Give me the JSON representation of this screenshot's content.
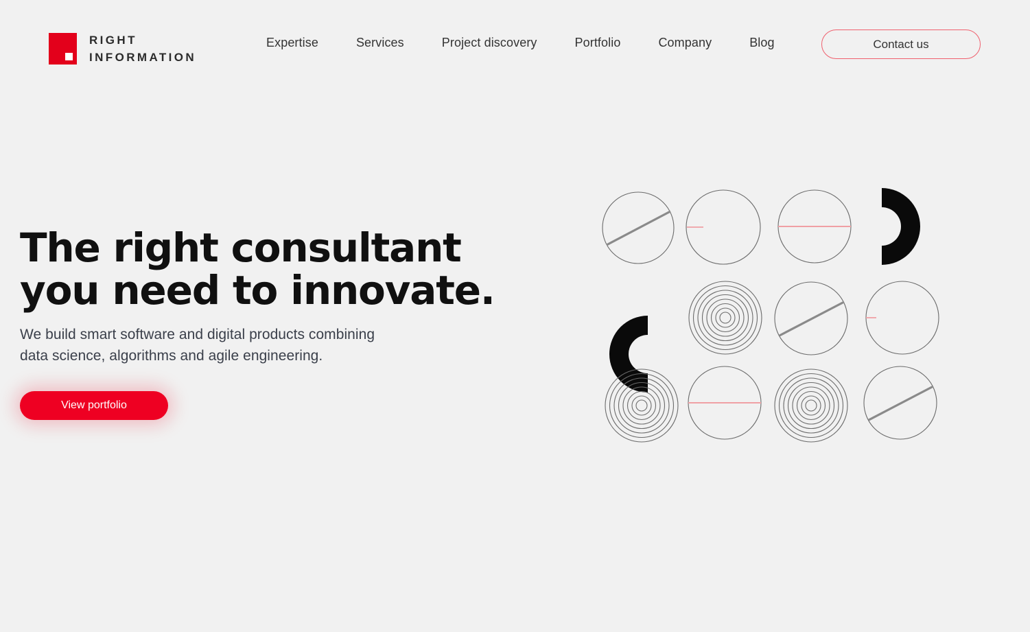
{
  "header": {
    "logo": {
      "icon": "red-square-logo-mark",
      "line1": "RIGHT",
      "line2": "INFORMATION",
      "brand_color": "#e3001b"
    },
    "nav_items": [
      {
        "label": "Expertise"
      },
      {
        "label": "Services"
      },
      {
        "label": "Project discovery"
      },
      {
        "label": "Portfolio"
      },
      {
        "label": "Company"
      },
      {
        "label": "Blog"
      }
    ],
    "contact_button": {
      "label": "Contact us",
      "border_color": "#ef5f6d"
    }
  },
  "hero": {
    "headline": "The right consultant\nyou need to innovate.",
    "subtitle": "We build smart software and digital products combining\ndata science, algorithms and agile engineering.",
    "cta": {
      "label": "View portfolio",
      "background_color": "#ee0022",
      "text_color": "#ffffff"
    }
  },
  "decoration": {
    "name": "circle-pattern-grid",
    "columns": 4,
    "rows": 3,
    "stroke_color": "#6b6b6b",
    "accent_color": "#f0a0a4",
    "solid_color": "#0a0a0a",
    "cells": [
      {
        "type": "circle-diagonal-chord"
      },
      {
        "type": "circle-short-red-radius"
      },
      {
        "type": "circle-red-diameter"
      },
      {
        "type": "black-crescent-right"
      },
      {
        "type": "black-crescent-left"
      },
      {
        "type": "concentric-rings"
      },
      {
        "type": "circle-diagonal-chord"
      },
      {
        "type": "circle-short-red-radius"
      },
      {
        "type": "concentric-rings"
      },
      {
        "type": "circle-red-diameter"
      },
      {
        "type": "concentric-rings"
      },
      {
        "type": "circle-diagonal-chord"
      }
    ]
  },
  "theme": {
    "background": "#f1f1f1",
    "text_primary": "#101010",
    "text_secondary": "#3a3f4a",
    "accent": "#ee0022"
  }
}
